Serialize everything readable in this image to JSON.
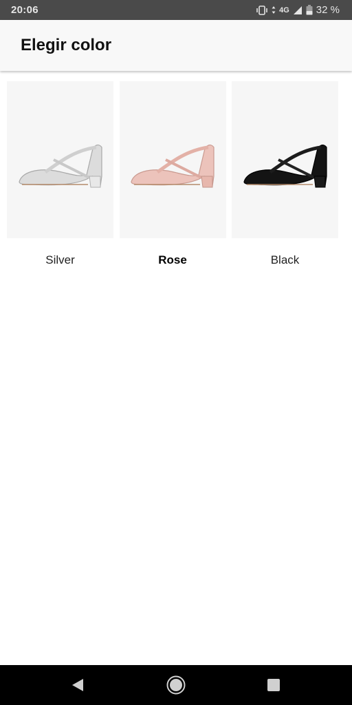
{
  "status_bar": {
    "time": "20:06",
    "network": "4G",
    "battery": "32 %"
  },
  "header": {
    "title": "Elegir color"
  },
  "color_options": [
    {
      "label": "Silver",
      "selected": false,
      "color": "#d9d9d9"
    },
    {
      "label": "Rose",
      "selected": true,
      "color": "#e9bcb5"
    },
    {
      "label": "Black",
      "selected": false,
      "color": "#111111"
    }
  ],
  "icons": {
    "vibrate": "vibrate-icon",
    "signal": "signal-icon",
    "battery": "battery-icon",
    "back": "back-triangle-icon",
    "home": "home-circle-icon",
    "recents": "recents-square-icon"
  }
}
